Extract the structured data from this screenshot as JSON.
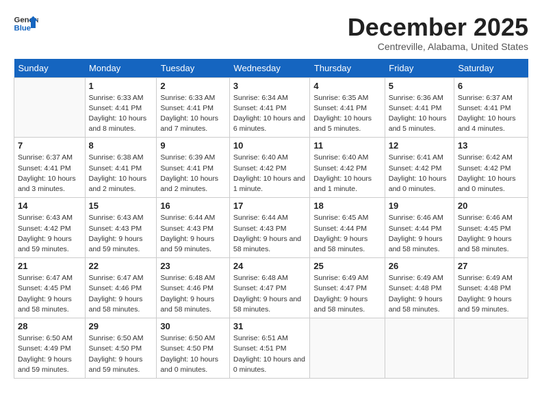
{
  "header": {
    "logo_line1": "General",
    "logo_line2": "Blue",
    "month_title": "December 2025",
    "subtitle": "Centreville, Alabama, United States"
  },
  "days_of_week": [
    "Sunday",
    "Monday",
    "Tuesday",
    "Wednesday",
    "Thursday",
    "Friday",
    "Saturday"
  ],
  "weeks": [
    [
      {
        "day": "",
        "content": ""
      },
      {
        "day": "1",
        "content": "Sunrise: 6:33 AM\nSunset: 4:41 PM\nDaylight: 10 hours and 8 minutes."
      },
      {
        "day": "2",
        "content": "Sunrise: 6:33 AM\nSunset: 4:41 PM\nDaylight: 10 hours and 7 minutes."
      },
      {
        "day": "3",
        "content": "Sunrise: 6:34 AM\nSunset: 4:41 PM\nDaylight: 10 hours and 6 minutes."
      },
      {
        "day": "4",
        "content": "Sunrise: 6:35 AM\nSunset: 4:41 PM\nDaylight: 10 hours and 5 minutes."
      },
      {
        "day": "5",
        "content": "Sunrise: 6:36 AM\nSunset: 4:41 PM\nDaylight: 10 hours and 5 minutes."
      },
      {
        "day": "6",
        "content": "Sunrise: 6:37 AM\nSunset: 4:41 PM\nDaylight: 10 hours and 4 minutes."
      }
    ],
    [
      {
        "day": "7",
        "content": "Sunrise: 6:37 AM\nSunset: 4:41 PM\nDaylight: 10 hours and 3 minutes."
      },
      {
        "day": "8",
        "content": "Sunrise: 6:38 AM\nSunset: 4:41 PM\nDaylight: 10 hours and 2 minutes."
      },
      {
        "day": "9",
        "content": "Sunrise: 6:39 AM\nSunset: 4:41 PM\nDaylight: 10 hours and 2 minutes."
      },
      {
        "day": "10",
        "content": "Sunrise: 6:40 AM\nSunset: 4:42 PM\nDaylight: 10 hours and 1 minute."
      },
      {
        "day": "11",
        "content": "Sunrise: 6:40 AM\nSunset: 4:42 PM\nDaylight: 10 hours and 1 minute."
      },
      {
        "day": "12",
        "content": "Sunrise: 6:41 AM\nSunset: 4:42 PM\nDaylight: 10 hours and 0 minutes."
      },
      {
        "day": "13",
        "content": "Sunrise: 6:42 AM\nSunset: 4:42 PM\nDaylight: 10 hours and 0 minutes."
      }
    ],
    [
      {
        "day": "14",
        "content": "Sunrise: 6:43 AM\nSunset: 4:42 PM\nDaylight: 9 hours and 59 minutes."
      },
      {
        "day": "15",
        "content": "Sunrise: 6:43 AM\nSunset: 4:43 PM\nDaylight: 9 hours and 59 minutes."
      },
      {
        "day": "16",
        "content": "Sunrise: 6:44 AM\nSunset: 4:43 PM\nDaylight: 9 hours and 59 minutes."
      },
      {
        "day": "17",
        "content": "Sunrise: 6:44 AM\nSunset: 4:43 PM\nDaylight: 9 hours and 58 minutes."
      },
      {
        "day": "18",
        "content": "Sunrise: 6:45 AM\nSunset: 4:44 PM\nDaylight: 9 hours and 58 minutes."
      },
      {
        "day": "19",
        "content": "Sunrise: 6:46 AM\nSunset: 4:44 PM\nDaylight: 9 hours and 58 minutes."
      },
      {
        "day": "20",
        "content": "Sunrise: 6:46 AM\nSunset: 4:45 PM\nDaylight: 9 hours and 58 minutes."
      }
    ],
    [
      {
        "day": "21",
        "content": "Sunrise: 6:47 AM\nSunset: 4:45 PM\nDaylight: 9 hours and 58 minutes."
      },
      {
        "day": "22",
        "content": "Sunrise: 6:47 AM\nSunset: 4:46 PM\nDaylight: 9 hours and 58 minutes."
      },
      {
        "day": "23",
        "content": "Sunrise: 6:48 AM\nSunset: 4:46 PM\nDaylight: 9 hours and 58 minutes."
      },
      {
        "day": "24",
        "content": "Sunrise: 6:48 AM\nSunset: 4:47 PM\nDaylight: 9 hours and 58 minutes."
      },
      {
        "day": "25",
        "content": "Sunrise: 6:49 AM\nSunset: 4:47 PM\nDaylight: 9 hours and 58 minutes."
      },
      {
        "day": "26",
        "content": "Sunrise: 6:49 AM\nSunset: 4:48 PM\nDaylight: 9 hours and 58 minutes."
      },
      {
        "day": "27",
        "content": "Sunrise: 6:49 AM\nSunset: 4:48 PM\nDaylight: 9 hours and 59 minutes."
      }
    ],
    [
      {
        "day": "28",
        "content": "Sunrise: 6:50 AM\nSunset: 4:49 PM\nDaylight: 9 hours and 59 minutes."
      },
      {
        "day": "29",
        "content": "Sunrise: 6:50 AM\nSunset: 4:50 PM\nDaylight: 9 hours and 59 minutes."
      },
      {
        "day": "30",
        "content": "Sunrise: 6:50 AM\nSunset: 4:50 PM\nDaylight: 10 hours and 0 minutes."
      },
      {
        "day": "31",
        "content": "Sunrise: 6:51 AM\nSunset: 4:51 PM\nDaylight: 10 hours and 0 minutes."
      },
      {
        "day": "",
        "content": ""
      },
      {
        "day": "",
        "content": ""
      },
      {
        "day": "",
        "content": ""
      }
    ]
  ]
}
